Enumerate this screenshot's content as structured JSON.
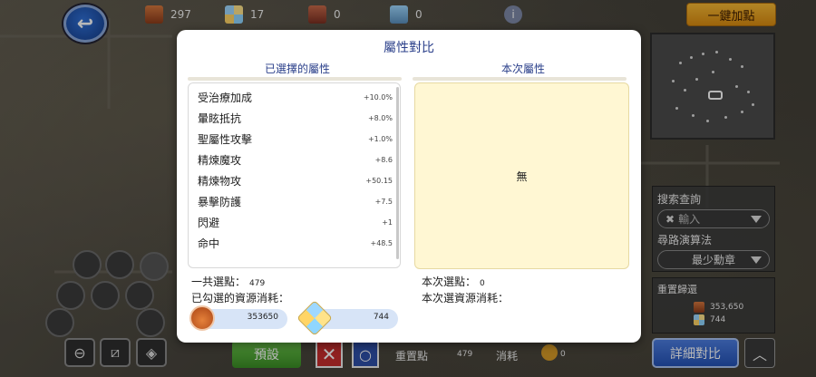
{
  "top_bar": {
    "resources": [
      {
        "icon": "medal-box-icon",
        "value": "297"
      },
      {
        "icon": "crystal-icon",
        "value": "17"
      },
      {
        "icon": "locked-box-icon",
        "value": "0"
      },
      {
        "icon": "crystal-box-icon",
        "value": "0"
      }
    ],
    "info_icon": "i",
    "one_click_button": "一鍵加點"
  },
  "modal": {
    "title": "屬性對比",
    "left_header": "已選擇的屬性",
    "right_header": "本次屬性",
    "attributes": [
      {
        "name": "受治療加成",
        "value": "+10.0%"
      },
      {
        "name": "暈眩抵抗",
        "value": "+8.0%"
      },
      {
        "name": "聖屬性攻擊",
        "value": "+1.0%"
      },
      {
        "name": "精煉魔攻",
        "value": "+8.6"
      },
      {
        "name": "精煉物攻",
        "value": "+50.15"
      },
      {
        "name": "暴擊防護",
        "value": "+7.5"
      },
      {
        "name": "閃避",
        "value": "+1"
      },
      {
        "name": "命中",
        "value": "+48.5"
      }
    ],
    "none_text": "無",
    "total_points_label": "一共選點：",
    "total_points_value": "479",
    "checked_cost_label": "已勾選的資源消耗：",
    "cost_medal": "353650",
    "cost_crystal": "744",
    "this_points_label": "本次選點：",
    "this_points_value": "0",
    "this_cost_label": "本次選資源消耗："
  },
  "right_panel": {
    "search_label": "搜索查詢",
    "search_placeholder": "輸入",
    "algo_label": "尋路演算法",
    "algo_value": "最少勳章",
    "reset_label": "重置歸還",
    "reset_medal": "353,650",
    "reset_crystal": "744",
    "detail_button": "詳細對比",
    "up_icon": "︿"
  },
  "bottom_bar": {
    "preset_button": "預設",
    "reset_points_label": "重置點",
    "reset_points_value": "479",
    "consume_label": "消耗",
    "consume_value": "0"
  }
}
